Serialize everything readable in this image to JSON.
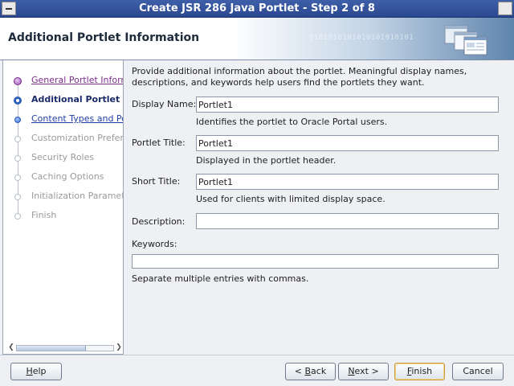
{
  "window": {
    "title": "Create JSR 286 Java Portlet - Step 2 of 8"
  },
  "header": {
    "title": "Additional Portlet Information",
    "decor_text": "0101010101010101010101"
  },
  "steps": [
    {
      "label": "General Portlet Informa",
      "state": "done"
    },
    {
      "label": "Additional Portlet Info",
      "state": "current"
    },
    {
      "label": "Content Types and Po",
      "state": "link"
    },
    {
      "label": "Customization Prefere",
      "state": "disabled"
    },
    {
      "label": "Security Roles",
      "state": "disabled"
    },
    {
      "label": "Caching Options",
      "state": "disabled"
    },
    {
      "label": "Initialization Paramete",
      "state": "disabled"
    },
    {
      "label": "Finish",
      "state": "disabled"
    }
  ],
  "form": {
    "intro": "Provide additional information about the portlet. Meaningful display names, descriptions, and keywords help users find the portlets they want.",
    "display_name": {
      "label": "Display Name:",
      "value": "Portlet1",
      "hint": "Identifies the portlet to Oracle Portal users."
    },
    "portlet_title": {
      "label": "Portlet Title:",
      "value": "Portlet1",
      "hint": "Displayed in the portlet header."
    },
    "short_title": {
      "label": "Short Title:",
      "value": "Portlet1",
      "hint": "Used for clients with limited display space."
    },
    "description": {
      "label": "Description:",
      "value": ""
    },
    "keywords": {
      "label": "Keywords:",
      "value": "",
      "hint": "Separate multiple entries with commas."
    }
  },
  "buttons": {
    "help": {
      "pre": "",
      "mn": "H",
      "post": "elp"
    },
    "back": {
      "pre": "< ",
      "mn": "B",
      "post": "ack"
    },
    "next": {
      "pre": "",
      "mn": "N",
      "post": "ext >"
    },
    "finish": {
      "pre": "",
      "mn": "F",
      "post": "inish"
    },
    "cancel": {
      "pre": "Cancel",
      "mn": "",
      "post": ""
    }
  },
  "colors": {
    "title_bar": "#2a4890",
    "link": "#1f3fa6",
    "visited_link": "#7b2d8b",
    "current_step": "#1a2a6c"
  }
}
